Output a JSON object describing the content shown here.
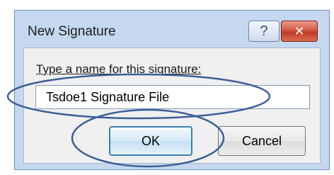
{
  "window": {
    "title": "New Signature",
    "help_label": "?",
    "close_label": "✕"
  },
  "form": {
    "prompt": "Type a name for this signature:",
    "name_value": "Tsdoe1 Signature File"
  },
  "buttons": {
    "ok_label": "OK",
    "cancel_label": "Cancel"
  },
  "annotations": {
    "highlight_color": "#3c5f99",
    "highlighted": [
      "name-input",
      "ok-button"
    ]
  }
}
